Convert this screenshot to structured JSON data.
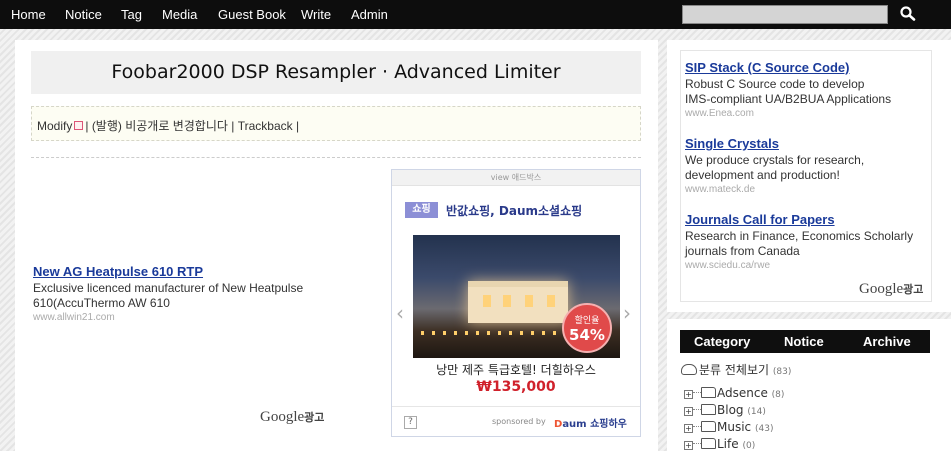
{
  "nav": {
    "items": [
      "Home",
      "Notice",
      "Tag",
      "Media",
      "Guest Book",
      "Write",
      "Admin"
    ],
    "search_placeholder": ""
  },
  "post": {
    "title": "Foobar2000 DSP Resampler · Advanced Limiter",
    "modify_label": "Modify",
    "private_label": "(발행) 비공개로 변경합니다",
    "trackback_label": "Trackback",
    "sep": "|"
  },
  "google_ad_left": {
    "title": "New AG Heatpulse 610 RTP",
    "desc_line1": "Exclusive licenced manufacturer of New Heatpulse",
    "desc_line2": "610(AccuThermo AW 610",
    "url": "www.allwin21.com",
    "brand": "Google",
    "brand_suffix": "광고"
  },
  "view_adbox": {
    "header": "view 애드박스",
    "badge": "쇼핑",
    "headline": "반값쇼핑, Daum소셜쇼핑",
    "sale_label": "할인율",
    "sale_percent": "54%",
    "caption": "낭만 제주 특급호텔! 더힐하우스",
    "price": "₩135,000",
    "help": "?",
    "sponsored_by": "sponsored by",
    "daum_d": "D",
    "daum_rest": "aum 쇼핑하우",
    "prev": "‹",
    "next": "›"
  },
  "sidebar_ads": {
    "items": [
      {
        "title": "SIP Stack (C Source Code)",
        "desc_line1": "Robust C Source code to develop",
        "desc_line2": "IMS-compliant UA/B2BUA Applications",
        "url": "www.Enea.com"
      },
      {
        "title": "Single Crystals",
        "desc_line1": "We produce crystals for research,",
        "desc_line2": "development and production!",
        "url": "www.mateck.de"
      },
      {
        "title": "Journals Call for Papers",
        "desc_line1": "Research in Finance, Economics Scholarly",
        "desc_line2": "journals from Canada",
        "url": "www.sciedu.ca/rwe"
      }
    ],
    "brand": "Google",
    "brand_suffix": "광고"
  },
  "widget": {
    "tabs": [
      "Category",
      "Notice",
      "Archive"
    ],
    "root_label": "분류 전체보기",
    "root_count": "(83)",
    "categories": [
      {
        "label": "Adsence",
        "count": "(8)"
      },
      {
        "label": "Blog",
        "count": "(14)"
      },
      {
        "label": "Music",
        "count": "(43)"
      },
      {
        "label": "Life",
        "count": "(0)"
      }
    ]
  }
}
